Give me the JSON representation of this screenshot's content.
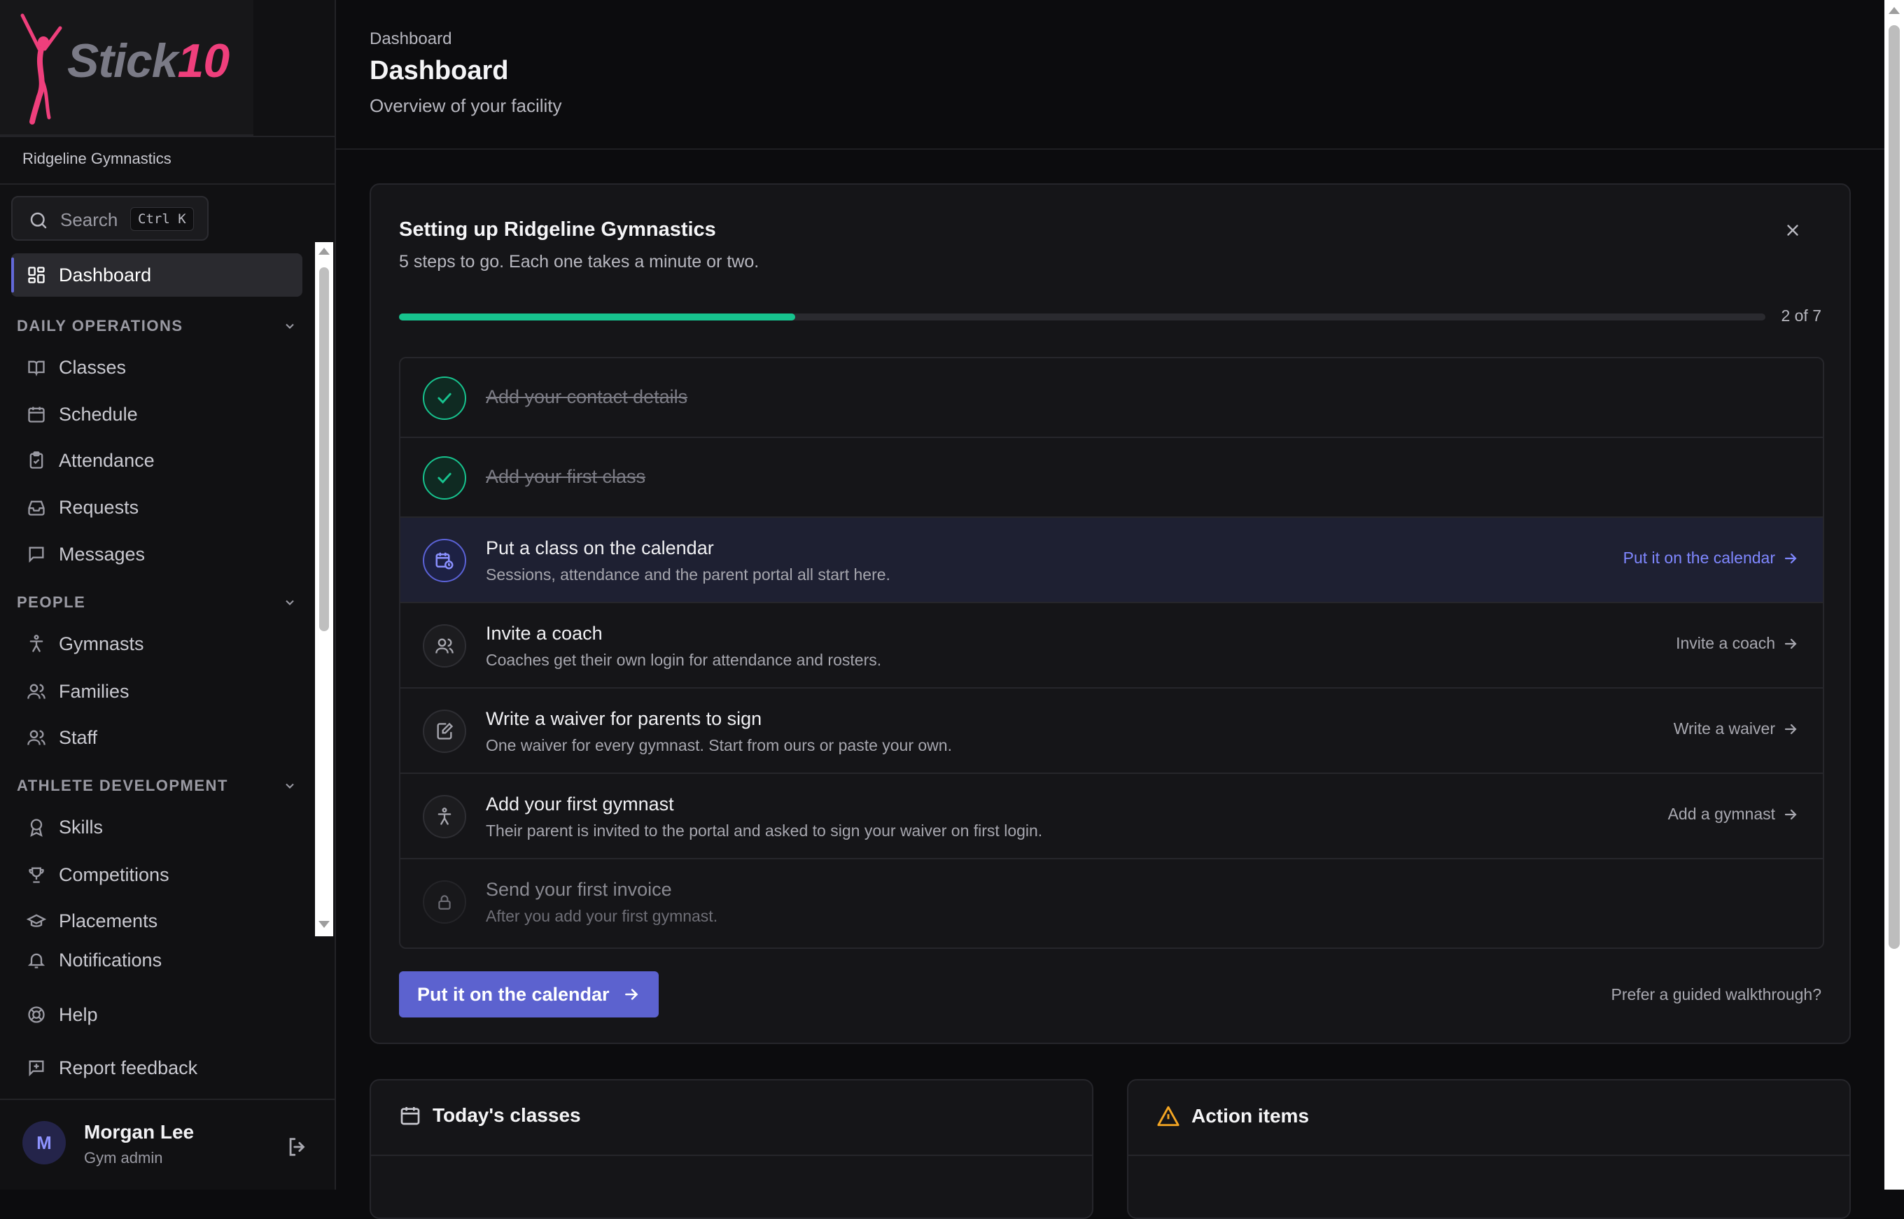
{
  "brand": {
    "logo_word": "Stick",
    "logo_num": "10",
    "org_name": "Ridgeline Gymnastics",
    "colors": {
      "logo_pink": "#ef3f7c",
      "accent": "#5c62cf",
      "success": "#17c38e"
    }
  },
  "search": {
    "label": "Search",
    "shortcut": "Ctrl K"
  },
  "nav": {
    "dashboard": {
      "label": "Dashboard",
      "icon": "grid-icon"
    },
    "sections": [
      {
        "title": "DAILY OPERATIONS",
        "items": [
          {
            "label": "Classes",
            "icon": "book-icon"
          },
          {
            "label": "Schedule",
            "icon": "calendar-icon"
          },
          {
            "label": "Attendance",
            "icon": "clipboard-check-icon"
          },
          {
            "label": "Requests",
            "icon": "inbox-icon"
          },
          {
            "label": "Messages",
            "icon": "message-icon"
          }
        ]
      },
      {
        "title": "PEOPLE",
        "items": [
          {
            "label": "Gymnasts",
            "icon": "person-icon"
          },
          {
            "label": "Families",
            "icon": "users-icon"
          },
          {
            "label": "Staff",
            "icon": "users-icon"
          }
        ]
      },
      {
        "title": "ATHLETE DEVELOPMENT",
        "items": [
          {
            "label": "Skills",
            "icon": "award-icon"
          },
          {
            "label": "Competitions",
            "icon": "trophy-icon"
          },
          {
            "label": "Placements",
            "icon": "graduation-cap-icon"
          }
        ]
      }
    ],
    "footer_items": [
      {
        "label": "Notifications",
        "icon": "bell-icon"
      },
      {
        "label": "Help",
        "icon": "lifebuoy-icon"
      },
      {
        "label": "Report feedback",
        "icon": "feedback-icon"
      }
    ]
  },
  "user": {
    "initial": "M",
    "name": "Morgan Lee",
    "role": "Gym admin"
  },
  "header": {
    "breadcrumb": "Dashboard",
    "title": "Dashboard",
    "subtitle": "Overview of your facility"
  },
  "setup": {
    "title": "Setting up Ridgeline Gymnastics",
    "subtitle": "5 steps to go. Each one takes a minute or two.",
    "progress_fraction": 0.29,
    "progress_label": "2 of 7",
    "steps": [
      {
        "title": "Add your contact details",
        "status": "done"
      },
      {
        "title": "Add your first class",
        "status": "done"
      },
      {
        "title": "Put a class on the calendar",
        "desc": "Sessions, attendance and the parent portal all start here.",
        "action": "Put it on the calendar",
        "status": "current",
        "icon": "calendar-clock-icon"
      },
      {
        "title": "Invite a coach",
        "desc": "Coaches get their own login for attendance and rosters.",
        "action": "Invite a coach",
        "status": "todo",
        "icon": "users-icon"
      },
      {
        "title": "Write a waiver for parents to sign",
        "desc": "One waiver for every gymnast. Start from ours or paste your own.",
        "action": "Write a waiver",
        "status": "todo",
        "icon": "edit-document-icon"
      },
      {
        "title": "Add your first gymnast",
        "desc": "Their parent is invited to the portal and asked to sign your waiver on first login.",
        "action": "Add a gymnast",
        "status": "todo",
        "icon": "person-icon"
      },
      {
        "title": "Send your first invoice",
        "desc": "After you add your first gymnast.",
        "status": "locked",
        "icon": "lock-icon"
      }
    ],
    "cta_label": "Put it on the calendar",
    "walkthrough_label": "Prefer a guided walkthrough?"
  },
  "panels": {
    "todays_classes": {
      "title": "Today's classes",
      "icon": "calendar-icon"
    },
    "action_items": {
      "title": "Action items",
      "icon": "warning-icon"
    }
  }
}
